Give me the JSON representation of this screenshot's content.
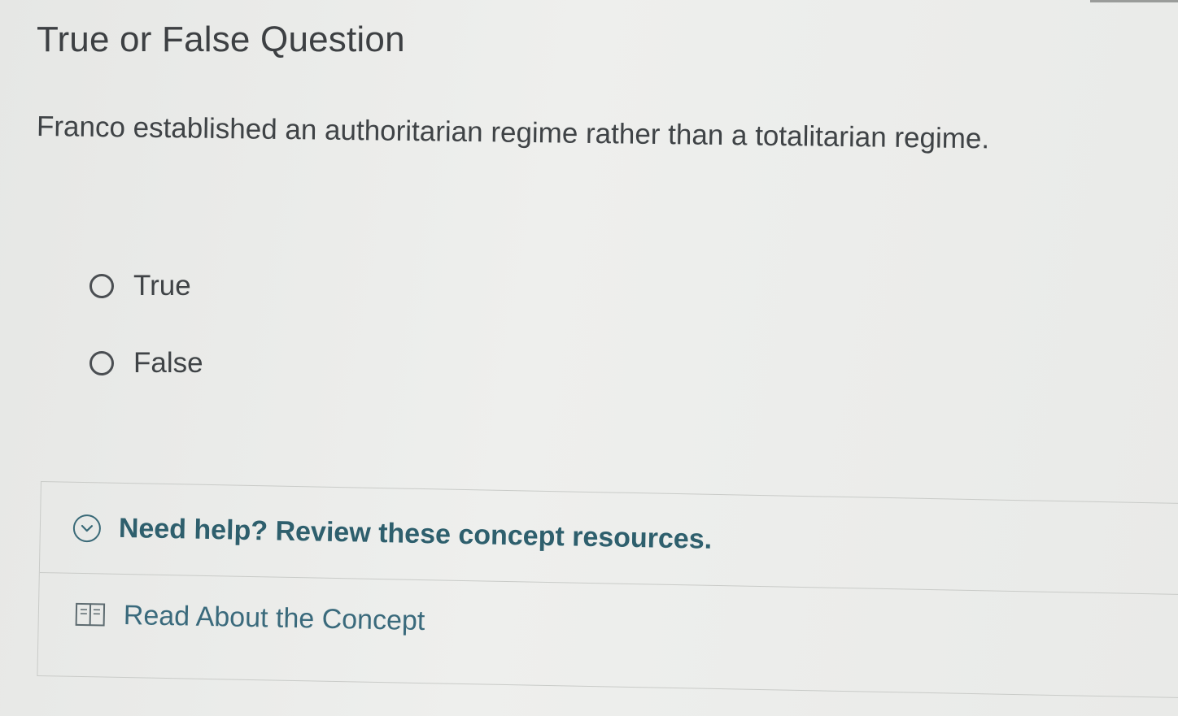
{
  "question": {
    "heading": "True or False Question",
    "prompt": "Franco established an authoritarian regime rather than a totalitarian regime."
  },
  "options": [
    {
      "label": "True",
      "selected": false
    },
    {
      "label": "False",
      "selected": false
    }
  ],
  "help": {
    "title": "Need help? Review these concept resources.",
    "toggle_icon": "chevron-down-icon",
    "items": [
      {
        "label": "Read About the Concept",
        "icon": "book-icon"
      }
    ]
  },
  "colors": {
    "text": "#3f4346",
    "help_title": "#2e5f6d",
    "link": "#3a6a7c"
  }
}
